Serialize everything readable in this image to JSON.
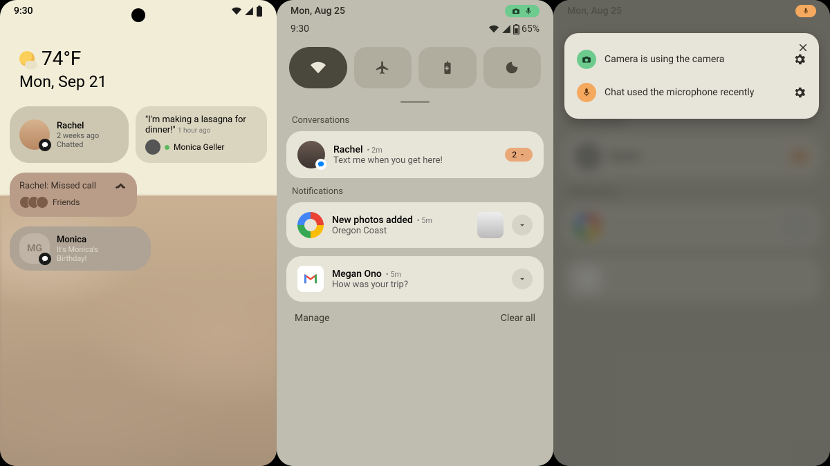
{
  "screen1": {
    "time": "9:30",
    "temperature": "74°F",
    "date": "Mon, Sep 21",
    "rachel_card": {
      "name": "Rachel",
      "sub1": "2 weeks ago",
      "sub2": "Chatted"
    },
    "lasagna_bubble": {
      "quote": "\"I'm making a lasagna for dinner!\"",
      "time": "1 hour ago",
      "from": "Monica Geller"
    },
    "missed_call": {
      "title": "Rachel: Missed call",
      "friends": "Friends"
    },
    "monica_card": {
      "initials": "MG",
      "name": "Monica",
      "sub1": "It's Monica's",
      "sub2": "Birthday!"
    }
  },
  "screen2": {
    "date": "Mon, Aug 25",
    "time": "9:30",
    "battery": "65%",
    "sections": {
      "conversations": "Conversations",
      "notifications": "Notifications"
    },
    "conv": {
      "name": "Rachel",
      "time": "2m",
      "body": "Text me when you get here!",
      "count": "2"
    },
    "photos": {
      "title": "New photos added",
      "time": "5m",
      "body": "Oregon Coast"
    },
    "gmail": {
      "name": "Megan Ono",
      "time": "5m",
      "body": "How was your trip?"
    },
    "manage": "Manage",
    "clear": "Clear all"
  },
  "screen3": {
    "camera_text": "Camera is using the camera",
    "mic_text": "Chat used the microphone recently"
  }
}
